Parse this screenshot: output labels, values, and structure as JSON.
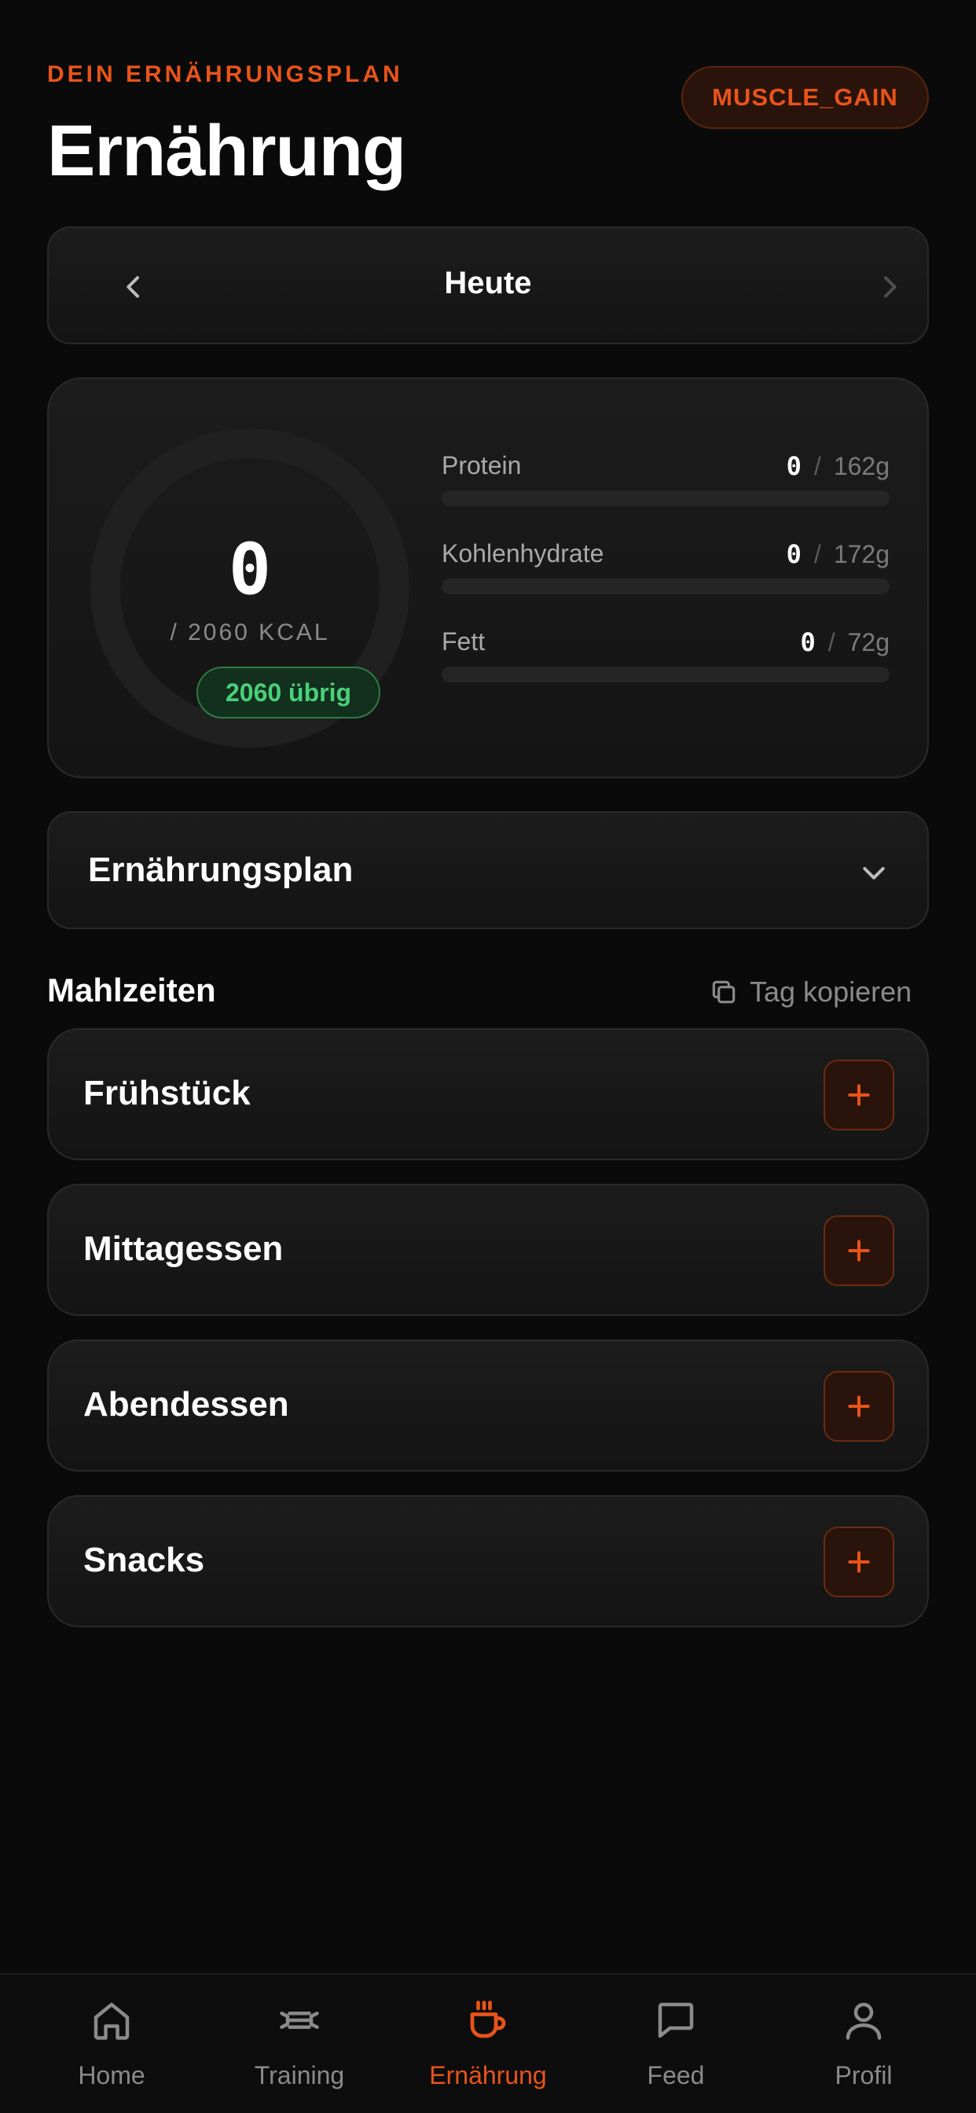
{
  "header": {
    "eyebrow": "DEIN ERNÄHRUNGSPLAN",
    "title": "Ernährung",
    "goal_badge": "MUSCLE_GAIN"
  },
  "day_nav": {
    "label": "Heute"
  },
  "summary": {
    "kcal_value": "0",
    "kcal_target": "/ 2060 KCAL",
    "remaining": "2060 übrig",
    "macros": [
      {
        "name": "Protein",
        "current": "0",
        "target": "162g",
        "progress": 0
      },
      {
        "name": "Kohlenhydrate",
        "current": "0",
        "target": "172g",
        "progress": 0
      },
      {
        "name": "Fett",
        "current": "0",
        "target": "72g",
        "progress": 0
      }
    ]
  },
  "plan": {
    "label": "Ernährungsplan"
  },
  "meals": {
    "title": "Mahlzeiten",
    "copy_day": "Tag kopieren",
    "items": [
      {
        "label": "Frühstück"
      },
      {
        "label": "Mittagessen"
      },
      {
        "label": "Abendessen"
      },
      {
        "label": "Snacks"
      }
    ]
  },
  "tabbar": {
    "items": [
      {
        "label": "Home",
        "icon": "home-icon"
      },
      {
        "label": "Training",
        "icon": "dumbbell-icon"
      },
      {
        "label": "Ernährung",
        "icon": "cup-icon",
        "active": true
      },
      {
        "label": "Feed",
        "icon": "chat-icon"
      },
      {
        "label": "Profil",
        "icon": "user-icon"
      }
    ]
  },
  "colors": {
    "accent": "#e8541a",
    "success": "#49d17a",
    "background": "#0a0a0a",
    "card": "#1a1a1a"
  }
}
